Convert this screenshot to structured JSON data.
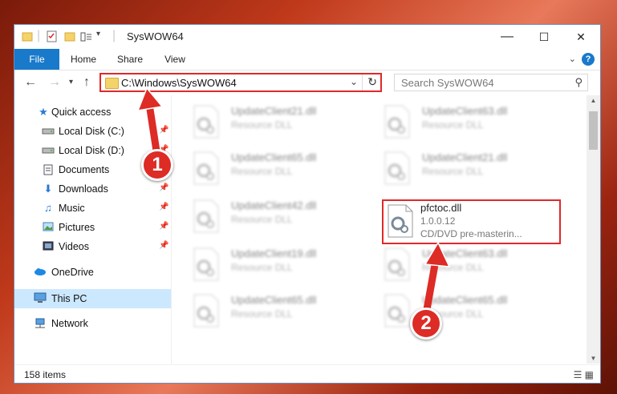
{
  "window": {
    "title": "SysWOW64",
    "controls": {
      "minimize": "—",
      "maximize": "☐",
      "close": "✕"
    }
  },
  "ribbon": {
    "tabs": [
      {
        "label": "File"
      },
      {
        "label": "Home"
      },
      {
        "label": "Share"
      },
      {
        "label": "View"
      }
    ],
    "help": "?"
  },
  "nav": {
    "address": "C:\\Windows\\SysWOW64",
    "search_placeholder": "Search SysWOW64"
  },
  "sidebar": {
    "items": [
      {
        "label": "Quick access",
        "icon": "star-icon"
      },
      {
        "label": "Local Disk (C:)",
        "icon": "drive-icon",
        "pinned": true
      },
      {
        "label": "Local Disk (D:)",
        "icon": "drive-icon",
        "pinned": true
      },
      {
        "label": "Documents",
        "icon": "documents-icon",
        "pinned": true
      },
      {
        "label": "Downloads",
        "icon": "download-icon",
        "pinned": true
      },
      {
        "label": "Music",
        "icon": "music-icon",
        "pinned": true
      },
      {
        "label": "Pictures",
        "icon": "pictures-icon",
        "pinned": true
      },
      {
        "label": "Videos",
        "icon": "videos-icon",
        "pinned": true
      },
      {
        "label": "OneDrive",
        "icon": "cloud-icon"
      },
      {
        "label": "This PC",
        "icon": "computer-icon",
        "selected": true
      },
      {
        "label": "Network",
        "icon": "network-icon"
      }
    ]
  },
  "files": [
    {
      "name": "UpdateClient21.dll",
      "type": "Resource DLL",
      "blurred": true
    },
    {
      "name": "UpdateClient63.dll",
      "type": "Resource DLL",
      "blurred": true
    },
    {
      "name": "UpdateClient65.dll",
      "type": "Resource DLL",
      "blurred": true
    },
    {
      "name": "UpdateClient21.dll",
      "type": "Resource DLL",
      "blurred": true
    },
    {
      "name": "UpdateClient42.dll",
      "type": "Resource DLL",
      "blurred": true
    },
    {
      "name": "pfctoc.dll",
      "version": "1.0.0.12",
      "type": "CD/DVD pre-masterin...",
      "blurred": false
    },
    {
      "name": "UpdateClient19.dll",
      "type": "Resource DLL",
      "blurred": true
    },
    {
      "name": "UpdateClient63.dll",
      "type": "Resource DLL",
      "blurred": true
    },
    {
      "name": "UpdateClient65.dll",
      "type": "Resource DLL",
      "blurred": true
    },
    {
      "name": "UpdateClient65.dll",
      "type": "Resource DLL",
      "blurred": true
    }
  ],
  "status": {
    "count": "158 items"
  },
  "annotations": [
    {
      "label": "1"
    },
    {
      "label": "2"
    }
  ],
  "colors": {
    "accent": "#1979ca",
    "highlight": "#e0282a",
    "selected": "#cce8ff"
  }
}
